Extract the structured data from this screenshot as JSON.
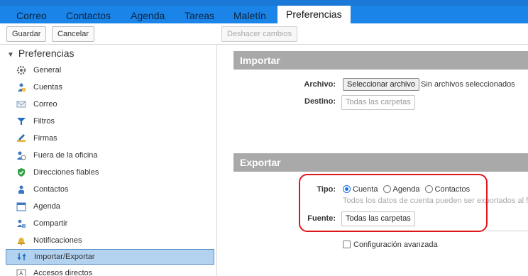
{
  "tabs": [
    {
      "label": "Correo"
    },
    {
      "label": "Contactos"
    },
    {
      "label": "Agenda"
    },
    {
      "label": "Tareas"
    },
    {
      "label": "Maletín"
    },
    {
      "label": "Preferencias",
      "active": true
    }
  ],
  "toolbar": {
    "save_label": "Guardar",
    "cancel_label": "Cancelar",
    "undo_label": "Deshacer cambios"
  },
  "sidebar": {
    "title": "Preferencias",
    "items": [
      {
        "label": "General",
        "icon": "gear-icon"
      },
      {
        "label": "Cuentas",
        "icon": "accounts-icon"
      },
      {
        "label": "Correo",
        "icon": "envelope-icon"
      },
      {
        "label": "Filtros",
        "icon": "filter-icon"
      },
      {
        "label": "Firmas",
        "icon": "signature-icon"
      },
      {
        "label": "Fuera de la oficina",
        "icon": "out-of-office-icon"
      },
      {
        "label": "Direcciones fiables",
        "icon": "shield-check-icon"
      },
      {
        "label": "Contactos",
        "icon": "contact-icon"
      },
      {
        "label": "Agenda",
        "icon": "calendar-icon"
      },
      {
        "label": "Compartir",
        "icon": "share-icon"
      },
      {
        "label": "Notificaciones",
        "icon": "bell-icon"
      },
      {
        "label": "Importar/Exportar",
        "icon": "import-export-icon",
        "selected": true
      },
      {
        "label": "Accesos directos",
        "icon": "shortcut-icon"
      }
    ]
  },
  "import": {
    "title": "Importar",
    "file_label": "Archivo:",
    "file_button": "Seleccionar archivo",
    "file_status": "Sin archivos seleccionados",
    "dest_label": "Destino:",
    "dest_value": "Todas las carpetas"
  },
  "export": {
    "title": "Exportar",
    "type_label": "Tipo:",
    "options": [
      {
        "label": "Cuenta",
        "checked": true
      },
      {
        "label": "Agenda",
        "checked": false
      },
      {
        "label": "Contactos",
        "checked": false
      }
    ],
    "hint": "Todos los datos de cuenta pueden ser exportados al for",
    "source_label": "Fuente:",
    "source_value": "Todas las carpetas",
    "advanced_label": "Configuración avanzada"
  },
  "colors": {
    "topbar": "#1a84e8",
    "section_header": "#a9a9a9",
    "selected_row": "#b2d2f0",
    "highlight": "#e0151b"
  }
}
